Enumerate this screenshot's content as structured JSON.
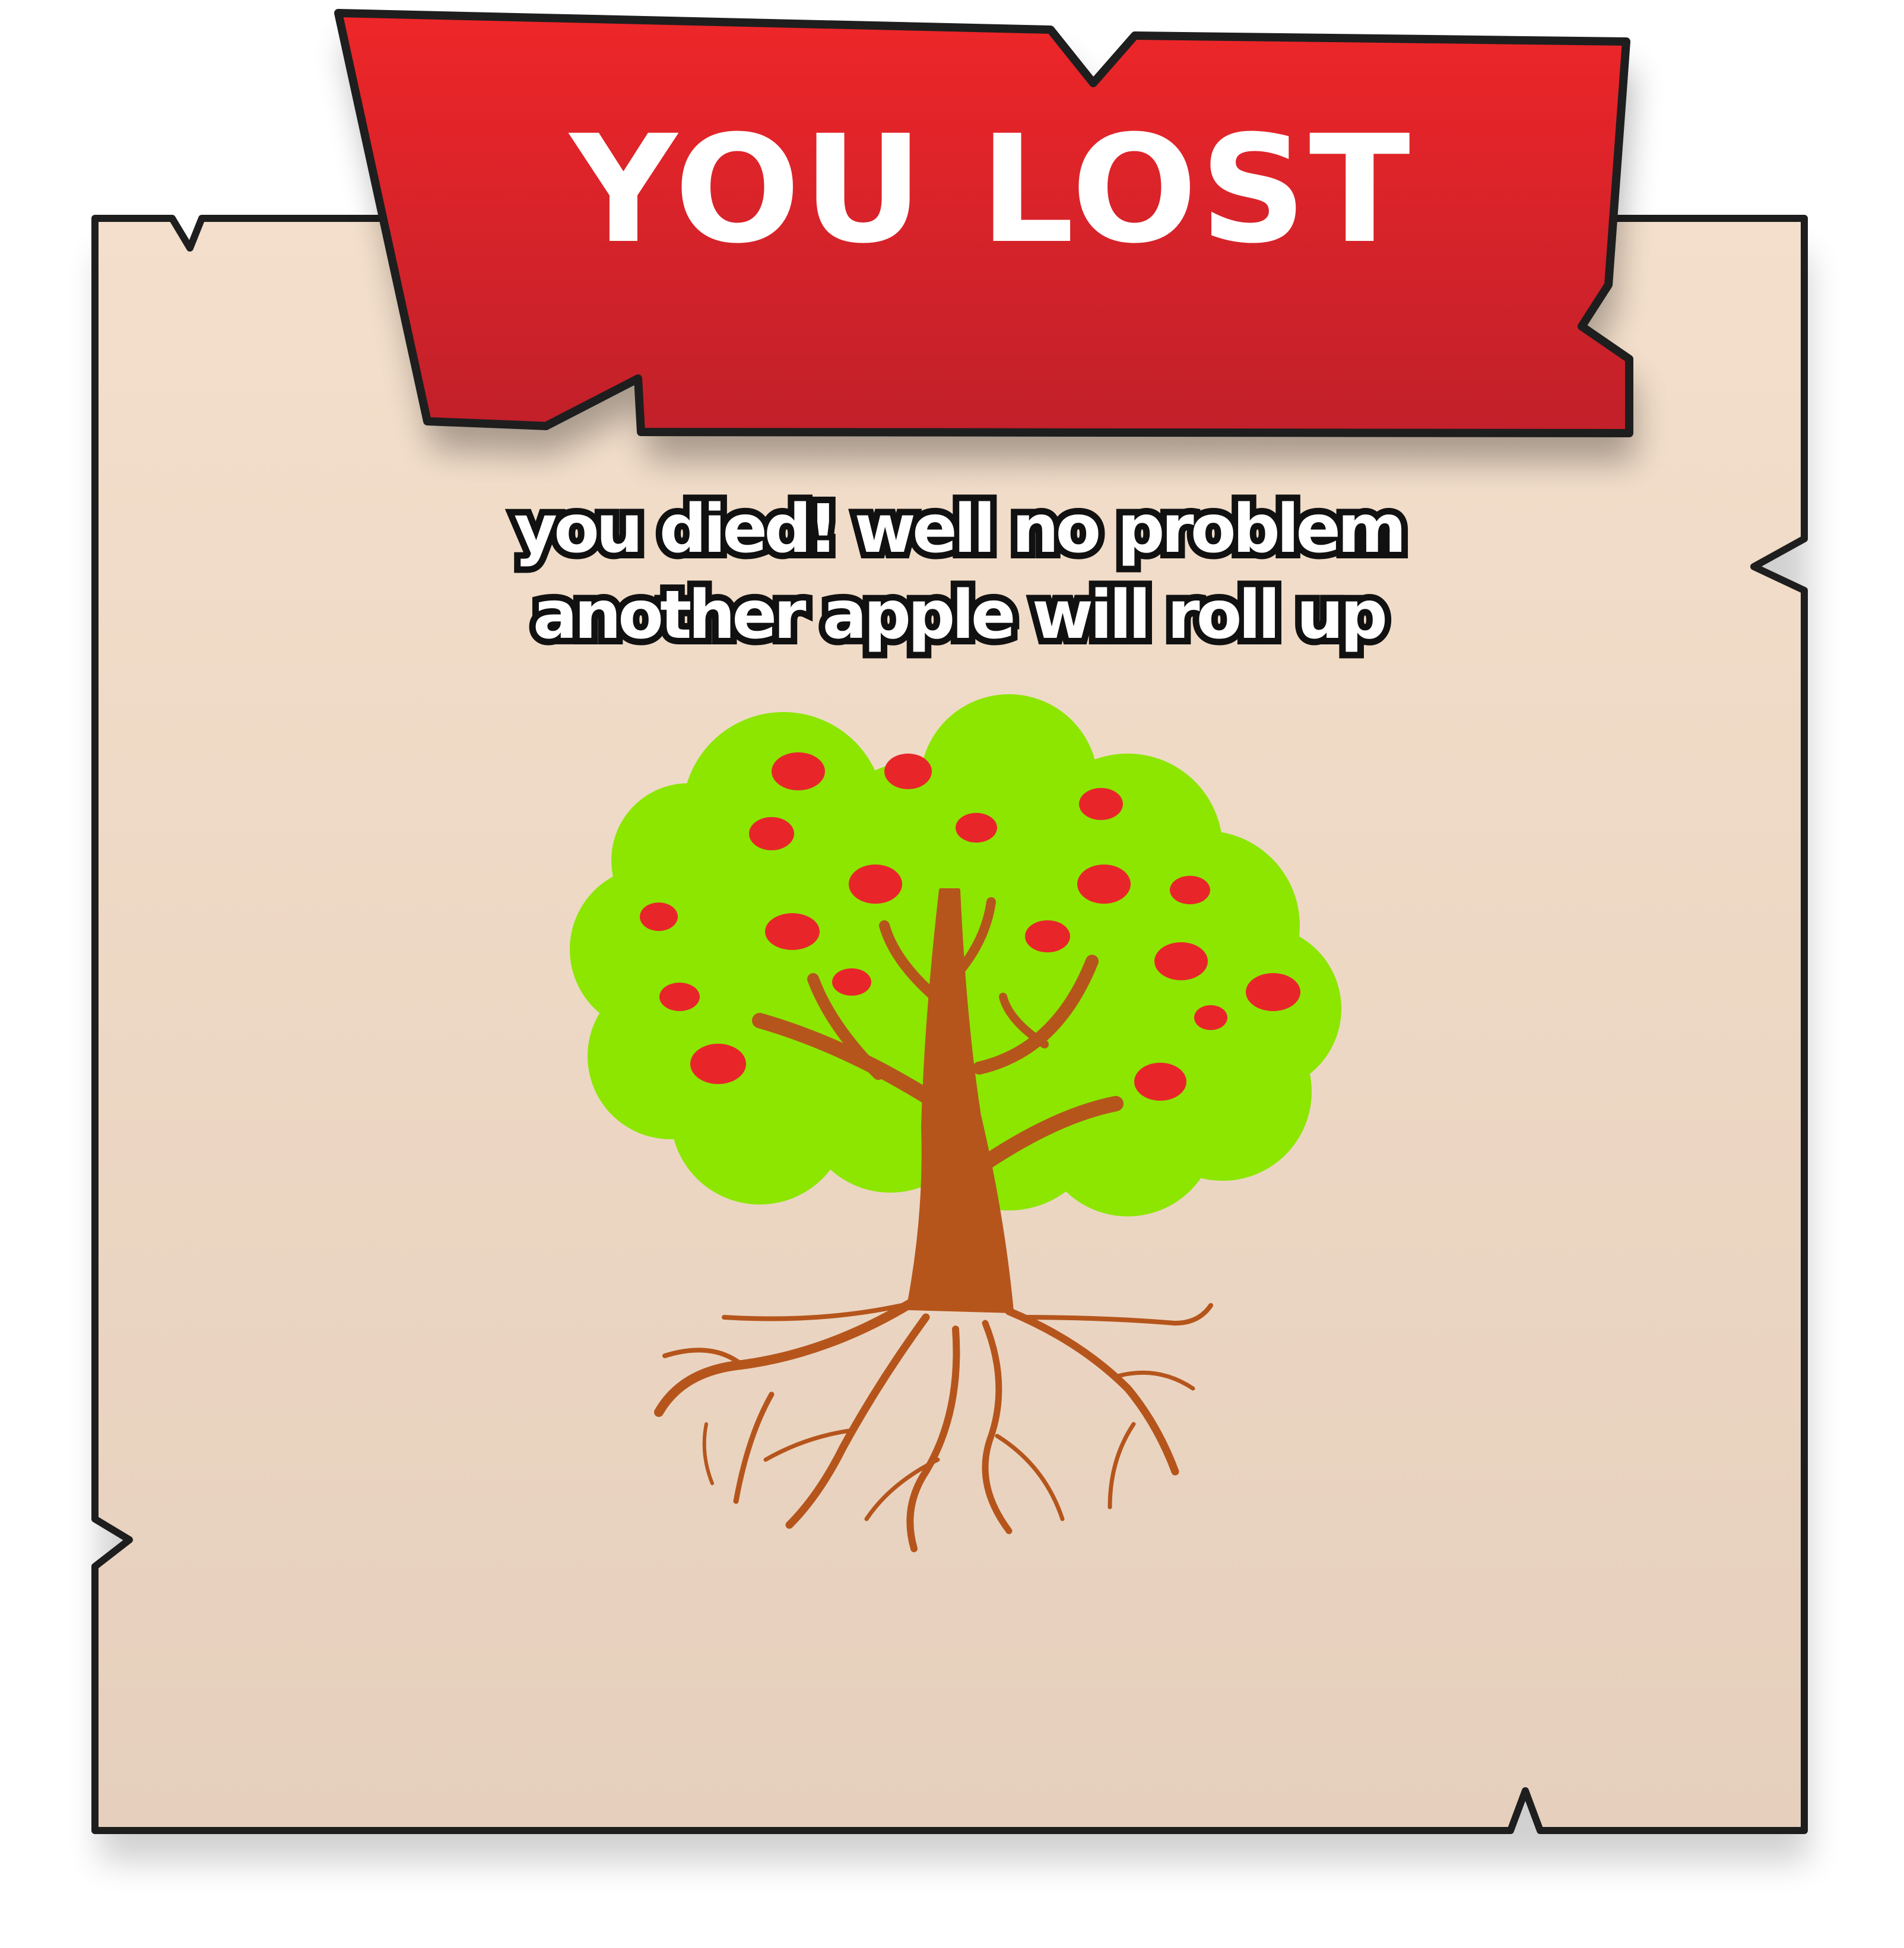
{
  "dialog": {
    "title": "YOU LOST",
    "message_line1": "you died!  well no problem",
    "message_line2": "another apple will roll up"
  },
  "illustration": {
    "subject": "apple-tree-icon"
  },
  "colors": {
    "parchment_top": "#F3DFCB",
    "parchment_bottom": "#E6D0BD",
    "banner_red": "#E8262A",
    "banner_red_dark": "#C1202A",
    "outline": "#1E1E1E",
    "leaf_green": "#8CE600",
    "apple_red": "#E8262A",
    "trunk_brown": "#B5551C"
  }
}
